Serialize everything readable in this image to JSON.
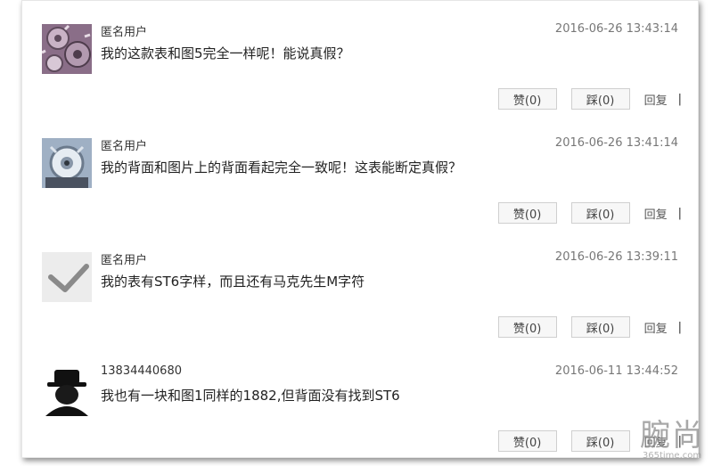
{
  "comments": [
    {
      "username": "匿名用户",
      "time": "2016-06-26 13:43:14",
      "text": "我的这款表和图5完全一样呢！能说真假？",
      "like": "赞(0)",
      "dislike": "踩(0)",
      "reply": "回复",
      "separator": "|",
      "avatar": "gears-icon"
    },
    {
      "username": "匿名用户",
      "time": "2016-06-26 13:41:14",
      "text": "我的背面和图片上的背面看起完全一致呢！这表能断定真假？",
      "like": "赞(0)",
      "dislike": "踩(0)",
      "reply": "回复",
      "separator": "|",
      "avatar": "watch-gear-icon"
    },
    {
      "username": "匿名用户",
      "time": "2016-06-26 13:39:11",
      "text": "我的表有ST6字样，而且还有马克先生M字符",
      "like": "赞(0)",
      "dislike": "踩(0)",
      "reply": "回复",
      "separator": "|",
      "avatar": "checkmark-icon"
    },
    {
      "username": "13834440680",
      "time": "2016-06-11 13:44:52",
      "text": "我也有一块和图1同样的1882,但背面没有找到ST6",
      "like": "赞(0)",
      "dislike": "踩(0)",
      "reply": "回复",
      "separator": "|",
      "avatar": "hat-person-icon"
    }
  ],
  "watermark": {
    "chars": "腕尚",
    "domain": "365time.com"
  }
}
